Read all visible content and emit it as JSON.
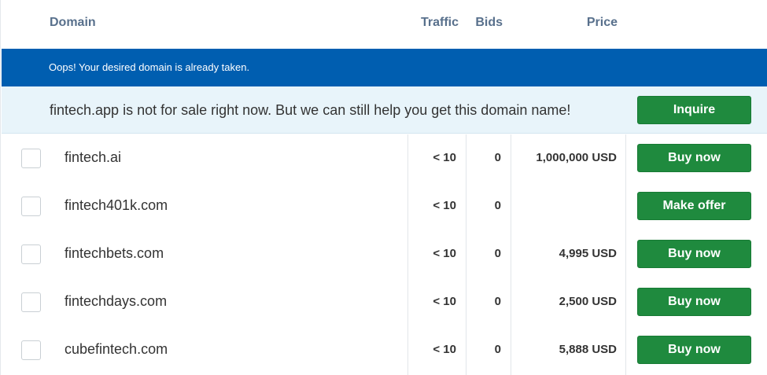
{
  "header": {
    "domain": "Domain",
    "traffic": "Traffic",
    "bids": "Bids",
    "price": "Price"
  },
  "alert": {
    "message": "Oops! Your desired domain is already taken."
  },
  "info": {
    "message": "fintech.app is not for sale right now. But we can still help you get this domain name!",
    "button": "Inquire"
  },
  "rows": [
    {
      "domain": "fintech.ai",
      "traffic": "< 10",
      "bids": "0",
      "price": "1,000,000 USD",
      "action": "Buy now"
    },
    {
      "domain": "fintech401k.com",
      "traffic": "< 10",
      "bids": "0",
      "price": "",
      "action": "Make offer"
    },
    {
      "domain": "fintechbets.com",
      "traffic": "< 10",
      "bids": "0",
      "price": "4,995 USD",
      "action": "Buy now"
    },
    {
      "domain": "fintechdays.com",
      "traffic": "< 10",
      "bids": "0",
      "price": "2,500 USD",
      "action": "Buy now"
    },
    {
      "domain": "cubefintech.com",
      "traffic": "< 10",
      "bids": "0",
      "price": "5,888 USD",
      "action": "Buy now"
    }
  ],
  "colors": {
    "alert_bg": "#005eb0",
    "info_bg": "#e8f4fa",
    "button_green": "#1f8a3e",
    "header_text": "#58708c"
  }
}
